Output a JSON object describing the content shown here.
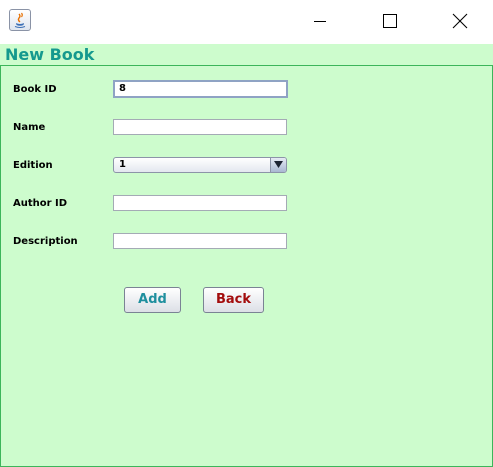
{
  "window": {
    "app_icon": "java-icon",
    "controls": [
      "minimize-icon",
      "maximize-icon",
      "close-icon"
    ]
  },
  "frame": {
    "title": "New Book"
  },
  "form": {
    "book_id_label": "Book ID",
    "book_id_value": "8",
    "name_label": "Name",
    "name_value": "",
    "edition_label": "Edition",
    "edition_selected": "1",
    "author_id_label": "Author ID",
    "author_id_value": "",
    "description_label": "Description",
    "description_value": ""
  },
  "buttons": {
    "add_label": "Add",
    "back_label": "Back"
  },
  "colors": {
    "background": "#cdfccd",
    "title": "#15998e",
    "add_text": "#1e8f9e",
    "back_text": "#a30d0d"
  }
}
